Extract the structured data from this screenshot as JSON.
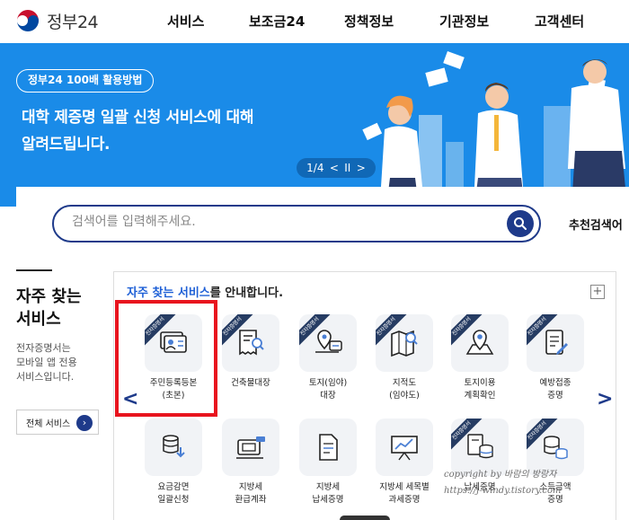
{
  "header": {
    "logo_text": "정부24",
    "nav": [
      "서비스",
      "보조금24",
      "정책정보",
      "기관정보",
      "고객센터"
    ]
  },
  "banner": {
    "pill": "정부24 100배 활용방법",
    "line1": "대학 제증명 일괄 신청 서비스에 대해",
    "line2": "알려드립니다.",
    "pager": {
      "position": "1/4",
      "prev": "<",
      "pause": "II",
      "next": ">"
    },
    "background_color": "#1a8be8"
  },
  "search": {
    "placeholder": "검색어를 입력해주세요.",
    "recommended": "추천검색어"
  },
  "left": {
    "title_line1": "자주 찾는",
    "title_line2": "서비스",
    "desc_line1": "전자증명서는",
    "desc_line2": "모바일 앱 전용",
    "desc_line3": "서비스입니다.",
    "all_button": "전체 서비스"
  },
  "services": {
    "heading_highlight": "자주 찾는 서비스",
    "heading_rest": "를 안내합니다.",
    "plus": "+",
    "badge_text": "전자증명서",
    "prev_arrow": "<",
    "next_arrow": ">",
    "items": [
      {
        "label": "주민등록등본\n(초본)",
        "icon": "id-card-icon"
      },
      {
        "label": "건축물대장",
        "icon": "receipt-search-icon"
      },
      {
        "label": "토지(임야)\n대장",
        "icon": "map-pin-card-icon"
      },
      {
        "label": "지적도\n(임야도)",
        "icon": "folded-map-search-icon"
      },
      {
        "label": "토지이용\n계획확인",
        "icon": "map-marker-icon"
      },
      {
        "label": "예방접종\n증명",
        "icon": "document-edit-icon"
      },
      {
        "label": "요금감면\n일괄신청",
        "icon": "coins-down-icon"
      },
      {
        "label": "지방세\n환급계좌",
        "icon": "wallet-card-icon"
      },
      {
        "label": "지방세\n납세증명",
        "icon": "document-icon"
      },
      {
        "label": "지방세 세목별\n과세증명",
        "icon": "presentation-chart-icon"
      },
      {
        "label": "납세증명",
        "icon": "document-coins-icon"
      },
      {
        "label": "소득금액\n증명",
        "icon": "coins-stack-icon"
      }
    ]
  },
  "watermark": {
    "line1": "copyright by 바람의 방랑자",
    "line2": "https://j-windy.tistory.com"
  },
  "colors": {
    "accent": "#1e3a8a",
    "highlight_red": "#e8141e",
    "link_blue": "#1e5fd6"
  }
}
